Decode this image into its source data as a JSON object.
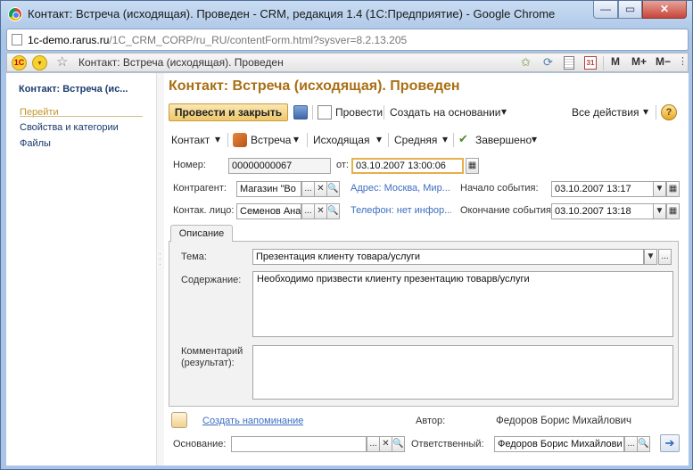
{
  "window": {
    "title": "Контакт: Встреча (исходящая). Проведен - CRM, редакция 1.4 (1С:Предприятие) - Google Chrome",
    "minimize_glyph": "—",
    "maximize_glyph": "▭",
    "close_glyph": "✕"
  },
  "address_bar": {
    "domain": "1c-demo.rarus.ru",
    "path": "/1C_CRM_CORP/ru_RU/contentForm.html?sysver=8.2.13.205"
  },
  "app_toolbar": {
    "logo_text": "1С",
    "page_title": "Контакт: Встреча (исходящая). Проведен",
    "m_label": "M",
    "m_plus_label": "M+",
    "m_minus_label": "M−",
    "calendar_day": "31",
    "dropdown_glyph": "▾"
  },
  "sidebar": {
    "title": "Контакт: Встреча (ис...",
    "goto_label": "Перейти",
    "items": [
      {
        "label": "Свойства и категории"
      },
      {
        "label": "Файлы"
      }
    ]
  },
  "form": {
    "title": "Контакт: Встреча (исходящая). Проведен",
    "toolbar": {
      "post_close_label": "Провести и закрыть",
      "post_label": "Провести",
      "create_based_label": "Создать на основании",
      "all_actions_label": "Все действия",
      "help_label": "?"
    },
    "status_bar": {
      "contact_label": "Контакт",
      "type_label": "Встреча",
      "direction_label": "Исходящая",
      "priority_label": "Средняя",
      "state_label": "Завершено"
    },
    "number_label": "Номер:",
    "number_value": "00000000067",
    "date_label": "от:",
    "date_value": "03.10.2007 13:00:06",
    "counterparty_label": "Контрагент:",
    "counterparty_value": "Магазин \"Во",
    "address_link": "Адрес: Москва, Мир...",
    "start_label": "Начало события:",
    "start_value": "03.10.2007 13:17",
    "contact_person_label": "Контак. лицо:",
    "contact_person_value": "Семенов Ана",
    "phone_link": "Телефон: нет инфор...",
    "end_label": "Окончание события:",
    "end_value": "03.10.2007 13:18",
    "tab_label": "Описание",
    "subject_label": "Тема:",
    "subject_value": "Презентация клиенту товара/услуги",
    "content_label": "Содержание:",
    "content_value": "Необходимо призвести клиенту презентацию товарв/услуги",
    "comment_label": "Комментарий (результат):",
    "comment_value": "",
    "reminder_link": "Создать напоминание",
    "author_label": "Автор:",
    "author_value": "Федоров Борис Михайлович",
    "basis_label": "Основание:",
    "basis_value": "",
    "responsible_label": "Ответственный:",
    "responsible_value": "Федоров Борис Михайлови",
    "select_glyph": "...",
    "clear_glyph": "✕",
    "search_glyph": "🔍",
    "dropdown_glyph": "▼",
    "menu_glyph": "▾"
  }
}
